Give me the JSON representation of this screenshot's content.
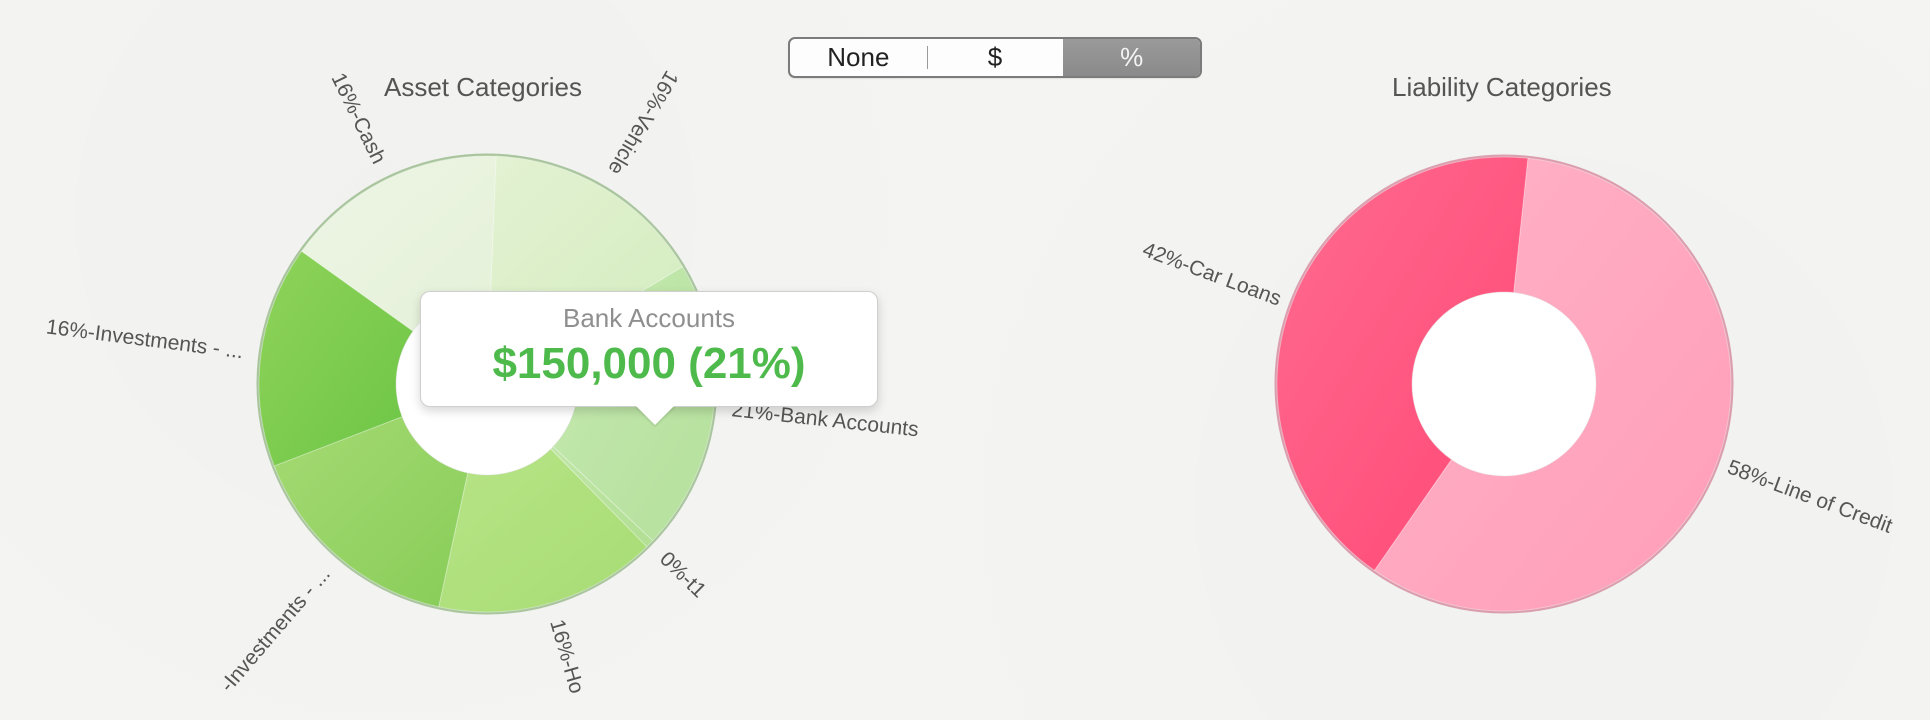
{
  "display_toggle": {
    "options": [
      "None",
      "$",
      "%"
    ],
    "selected": "%"
  },
  "asset_chart": {
    "title": "Asset Categories",
    "slices": [
      {
        "label": "21%-Bank Accounts",
        "percent": 21,
        "color_a": "#c6e9b2",
        "color_b": "#b4e09b"
      },
      {
        "label": "0%-t1",
        "percent": 0.6,
        "color_a": "#bfe6a6",
        "color_b": "#b2df94"
      },
      {
        "label": "16%-Ho",
        "percent": 16,
        "color_a": "#b7e487",
        "color_b": "#a7dc73"
      },
      {
        "label": "-Investments - ...",
        "percent": 16,
        "color_a": "#a5da73",
        "color_b": "#88cd59"
      },
      {
        "label": "16%-Investments - ...",
        "percent": 16,
        "color_a": "#8fd35a",
        "color_b": "#6cc545"
      },
      {
        "label": "16%-Cash",
        "percent": 16,
        "color_a": "#eef5e5",
        "color_b": "#e4f1d8"
      },
      {
        "label": "16%-Vehicle",
        "percent": 16,
        "color_a": "#e3f2d3",
        "color_b": "#d4ecbf"
      }
    ]
  },
  "liability_chart": {
    "title": "Liability Categories",
    "slices": [
      {
        "label": "58%-Line of Credit",
        "percent": 58,
        "color_a": "#ffb3c7",
        "color_b": "#ff9db8"
      },
      {
        "label": "42%-Car Loans",
        "percent": 42,
        "color_a": "#ff6b8f",
        "color_b": "#ff4775"
      }
    ]
  },
  "tooltip": {
    "title": "Bank Accounts",
    "value": "$150,000 (21%)"
  },
  "colors": {
    "accent_green": "#4dba4b",
    "toggle_active": "#8f8f8f"
  }
}
